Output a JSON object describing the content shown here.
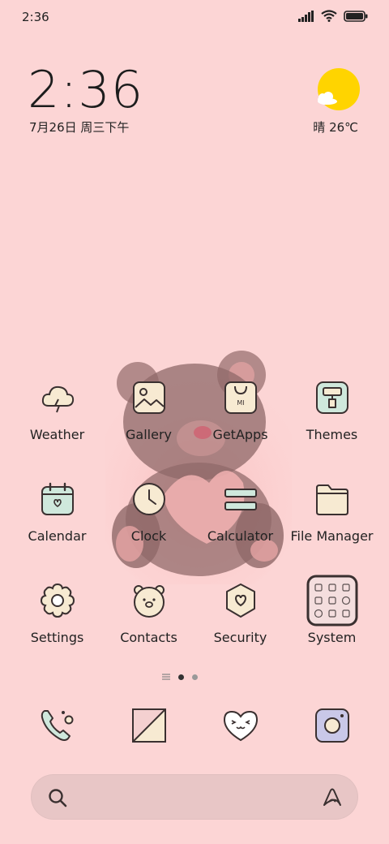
{
  "status": {
    "time": "2:36"
  },
  "widget": {
    "time": "2:36",
    "date": "7月26日 周三下午",
    "weather": "晴 26℃"
  },
  "apps": [
    {
      "label": "Weather"
    },
    {
      "label": "Gallery"
    },
    {
      "label": "GetApps"
    },
    {
      "label": "Themes"
    },
    {
      "label": "Calendar"
    },
    {
      "label": "Clock"
    },
    {
      "label": "Calculator"
    },
    {
      "label": "File Manager"
    },
    {
      "label": "Settings"
    },
    {
      "label": "Contacts"
    },
    {
      "label": "Security"
    },
    {
      "label": "System"
    }
  ],
  "colors": {
    "background": "#fcd5d5",
    "sun": "#ffd400",
    "icon_fill": "#f7ead2",
    "icon_mint": "#cfe8dc",
    "icon_stroke": "#3a3030"
  }
}
